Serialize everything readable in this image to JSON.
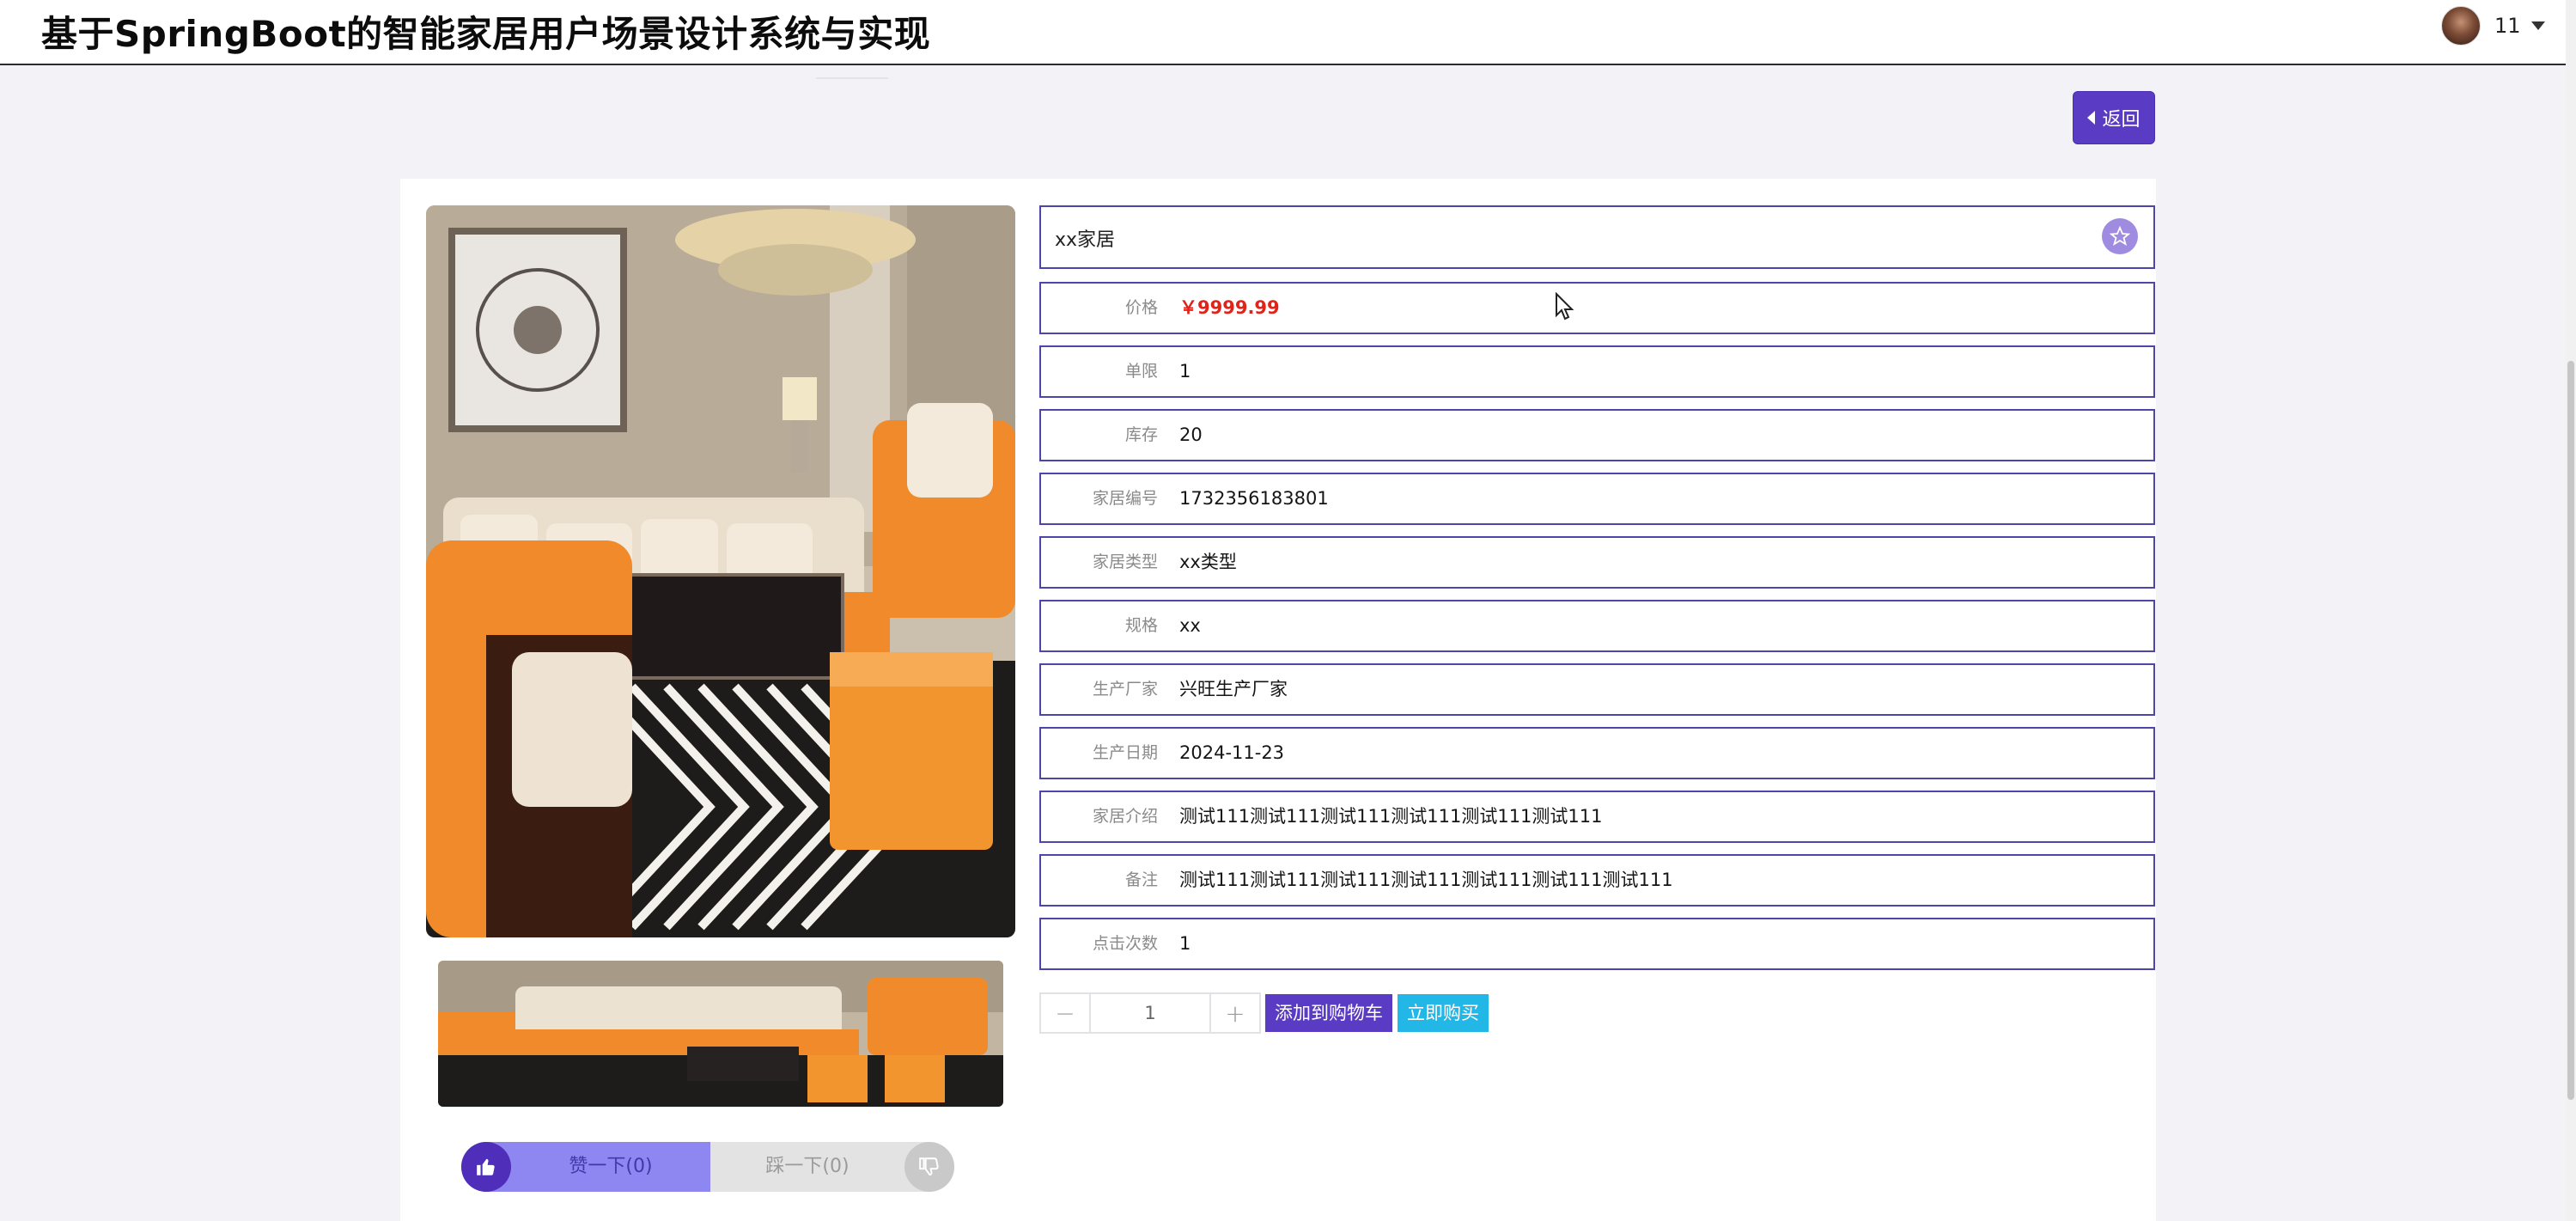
{
  "header": {
    "title": "基于SpringBoot的智能家居用户场景设计系统与实现",
    "username": "11"
  },
  "back_button": {
    "label": "返回"
  },
  "product": {
    "name": "xx家居",
    "fields": [
      {
        "label": "价格",
        "value": "￥9999.99",
        "type": "price"
      },
      {
        "label": "单限",
        "value": "1"
      },
      {
        "label": "库存",
        "value": "20"
      },
      {
        "label": "家居编号",
        "value": "1732356183801"
      },
      {
        "label": "家居类型",
        "value": "xx类型"
      },
      {
        "label": "规格",
        "value": "xx"
      },
      {
        "label": "生产厂家",
        "value": "兴旺生产厂家"
      },
      {
        "label": "生产日期",
        "value": "2024-11-23"
      },
      {
        "label": "家居介绍",
        "value": "测试111测试111测试111测试111测试111测试111"
      },
      {
        "label": "备注",
        "value": "测试111测试111测试111测试111测试111测试111测试111"
      },
      {
        "label": "点击次数",
        "value": "1"
      }
    ]
  },
  "quantity": {
    "minus": "−",
    "value": "1",
    "plus": "+"
  },
  "actions": {
    "add_to_cart": "添加到购物车",
    "buy_now": "立即购买"
  },
  "votes": {
    "like_label": "赞一下(0)",
    "dislike_label": "踩一下(0)"
  },
  "colors": {
    "accent": "#5a3cc4",
    "row_border": "#4d46a8",
    "price": "#e2231a",
    "buy_button": "#22b7e6",
    "like_fill": "#8e86f1"
  },
  "icons": [
    "caret-down-icon",
    "back-caret-icon",
    "star-icon",
    "thumbs-up-icon",
    "thumbs-down-icon",
    "mouse-cursor-icon"
  ]
}
